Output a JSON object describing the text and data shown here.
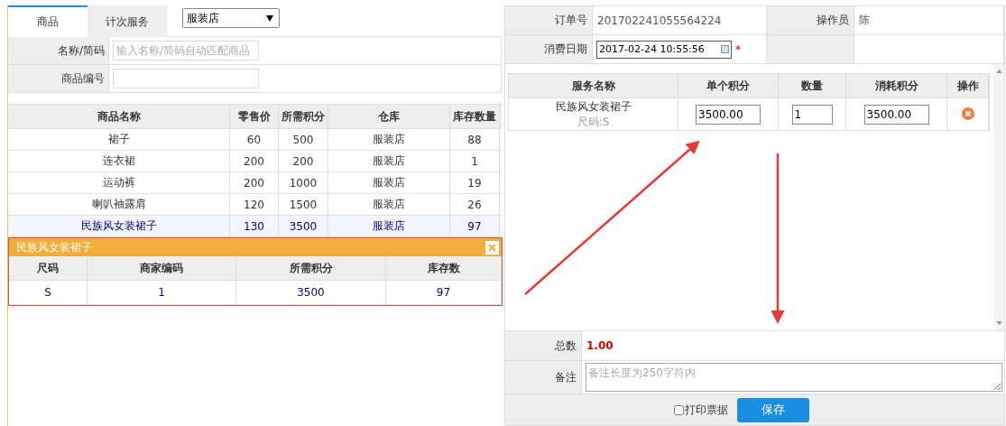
{
  "left": {
    "tabs": [
      {
        "label": "商品",
        "selected": true
      },
      {
        "label": "计次服务",
        "selected": false
      }
    ],
    "store_select": {
      "value": "服装店"
    },
    "form": [
      {
        "label": "名称/简码",
        "placeholder": "输入名称/简码自动匹配商品"
      },
      {
        "label": "商品编号"
      }
    ],
    "table": {
      "columns": [
        "商品名称",
        "零售价",
        "所需积分",
        "仓库",
        "库存数量"
      ],
      "rows": [
        {
          "cells": [
            "裙子",
            "60",
            "500",
            "服装店",
            "88"
          ],
          "selected": false
        },
        {
          "cells": [
            "连衣裙",
            "200",
            "200",
            "服装店",
            "1"
          ],
          "selected": false
        },
        {
          "cells": [
            "运动裤",
            "200",
            "1000",
            "服装店",
            "19"
          ],
          "selected": false
        },
        {
          "cells": [
            "喇叭袖露肩",
            "120",
            "1500",
            "服装店",
            "26"
          ],
          "selected": false
        },
        {
          "cells": [
            "民族风女装裙子",
            "130",
            "3500",
            "服装店",
            "97"
          ],
          "selected": true
        }
      ]
    },
    "popup": {
      "title": "民族风女装裙子",
      "columns": [
        "尺码",
        "商家编码",
        "所需积分",
        "库存数"
      ],
      "rows": [
        {
          "cells": [
            "S",
            "1",
            "3500",
            "97"
          ]
        }
      ]
    }
  },
  "right": {
    "order": [
      {
        "label": "订单号",
        "value": "201702241055564224"
      },
      {
        "label": "操作员",
        "value": "陈"
      }
    ],
    "date": {
      "label": "消费日期",
      "value": "2017-02-24 10:55:56",
      "required_mark": "*"
    },
    "service_table": {
      "columns": [
        "服务名称",
        "单个积分",
        "数量",
        "消耗积分",
        "操作"
      ],
      "rows": [
        {
          "name": "民族风女装裙子",
          "spec": "尺码:S",
          "unit_points": "3500.00",
          "quantity": "1",
          "total_points": "3500.00"
        }
      ]
    },
    "total": {
      "label": "总数",
      "value": "1.00"
    },
    "note": {
      "label": "备注",
      "placeholder": "备注长度为250字符内"
    },
    "print_receipt": {
      "label": "打印票据",
      "checked": false
    },
    "save_button": "保存"
  }
}
